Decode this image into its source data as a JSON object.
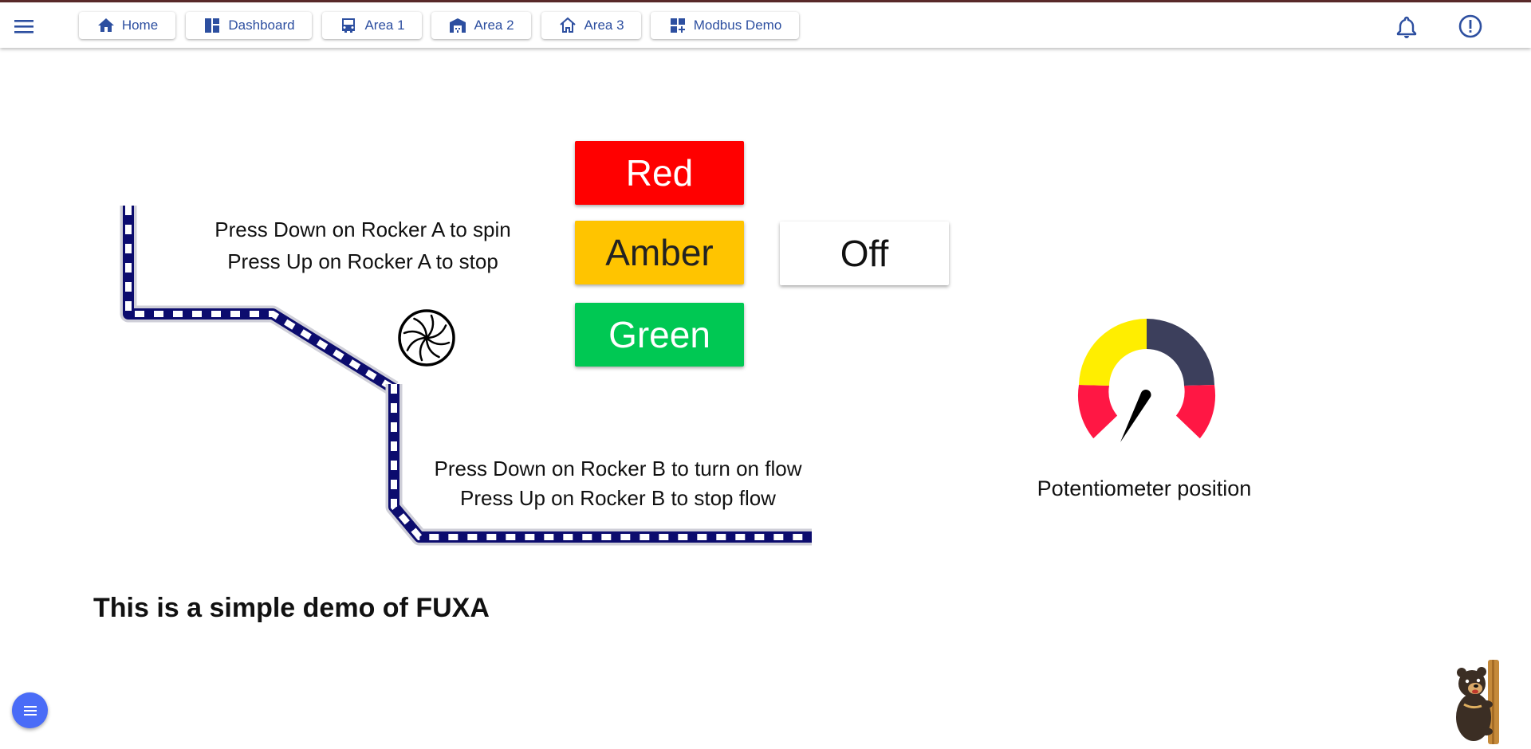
{
  "nav": {
    "buttons": [
      {
        "label": "Home",
        "icon": "home-icon"
      },
      {
        "label": "Dashboard",
        "icon": "dashboard-icon"
      },
      {
        "label": "Area 1",
        "icon": "car-icon"
      },
      {
        "label": "Area 2",
        "icon": "warehouse-icon"
      },
      {
        "label": "Area 3",
        "icon": "house-icon"
      },
      {
        "label": "Modbus Demo",
        "icon": "widgets-icon"
      }
    ],
    "accent": "#2d4fa0"
  },
  "lamps": {
    "red": {
      "label": "Red",
      "color": "#ff0000"
    },
    "amber": {
      "label": "Amber",
      "color": "#ffc400"
    },
    "green": {
      "label": "Green",
      "color": "#00c853"
    },
    "status": {
      "label": "Off"
    }
  },
  "instructions": {
    "rocker_a": [
      "Press Down on Rocker A to spin",
      "Press Up on Rocker A to stop"
    ],
    "rocker_b": [
      "Press Down on Rocker B to turn on flow",
      "Press Up on Rocker B to stop flow"
    ]
  },
  "gauge": {
    "label": "Potentiometer position",
    "bands": [
      "#ff1744",
      "#ffee00",
      "#3c3f5c",
      "#ff1744"
    ]
  },
  "title": "This is a simple demo of FUXA"
}
